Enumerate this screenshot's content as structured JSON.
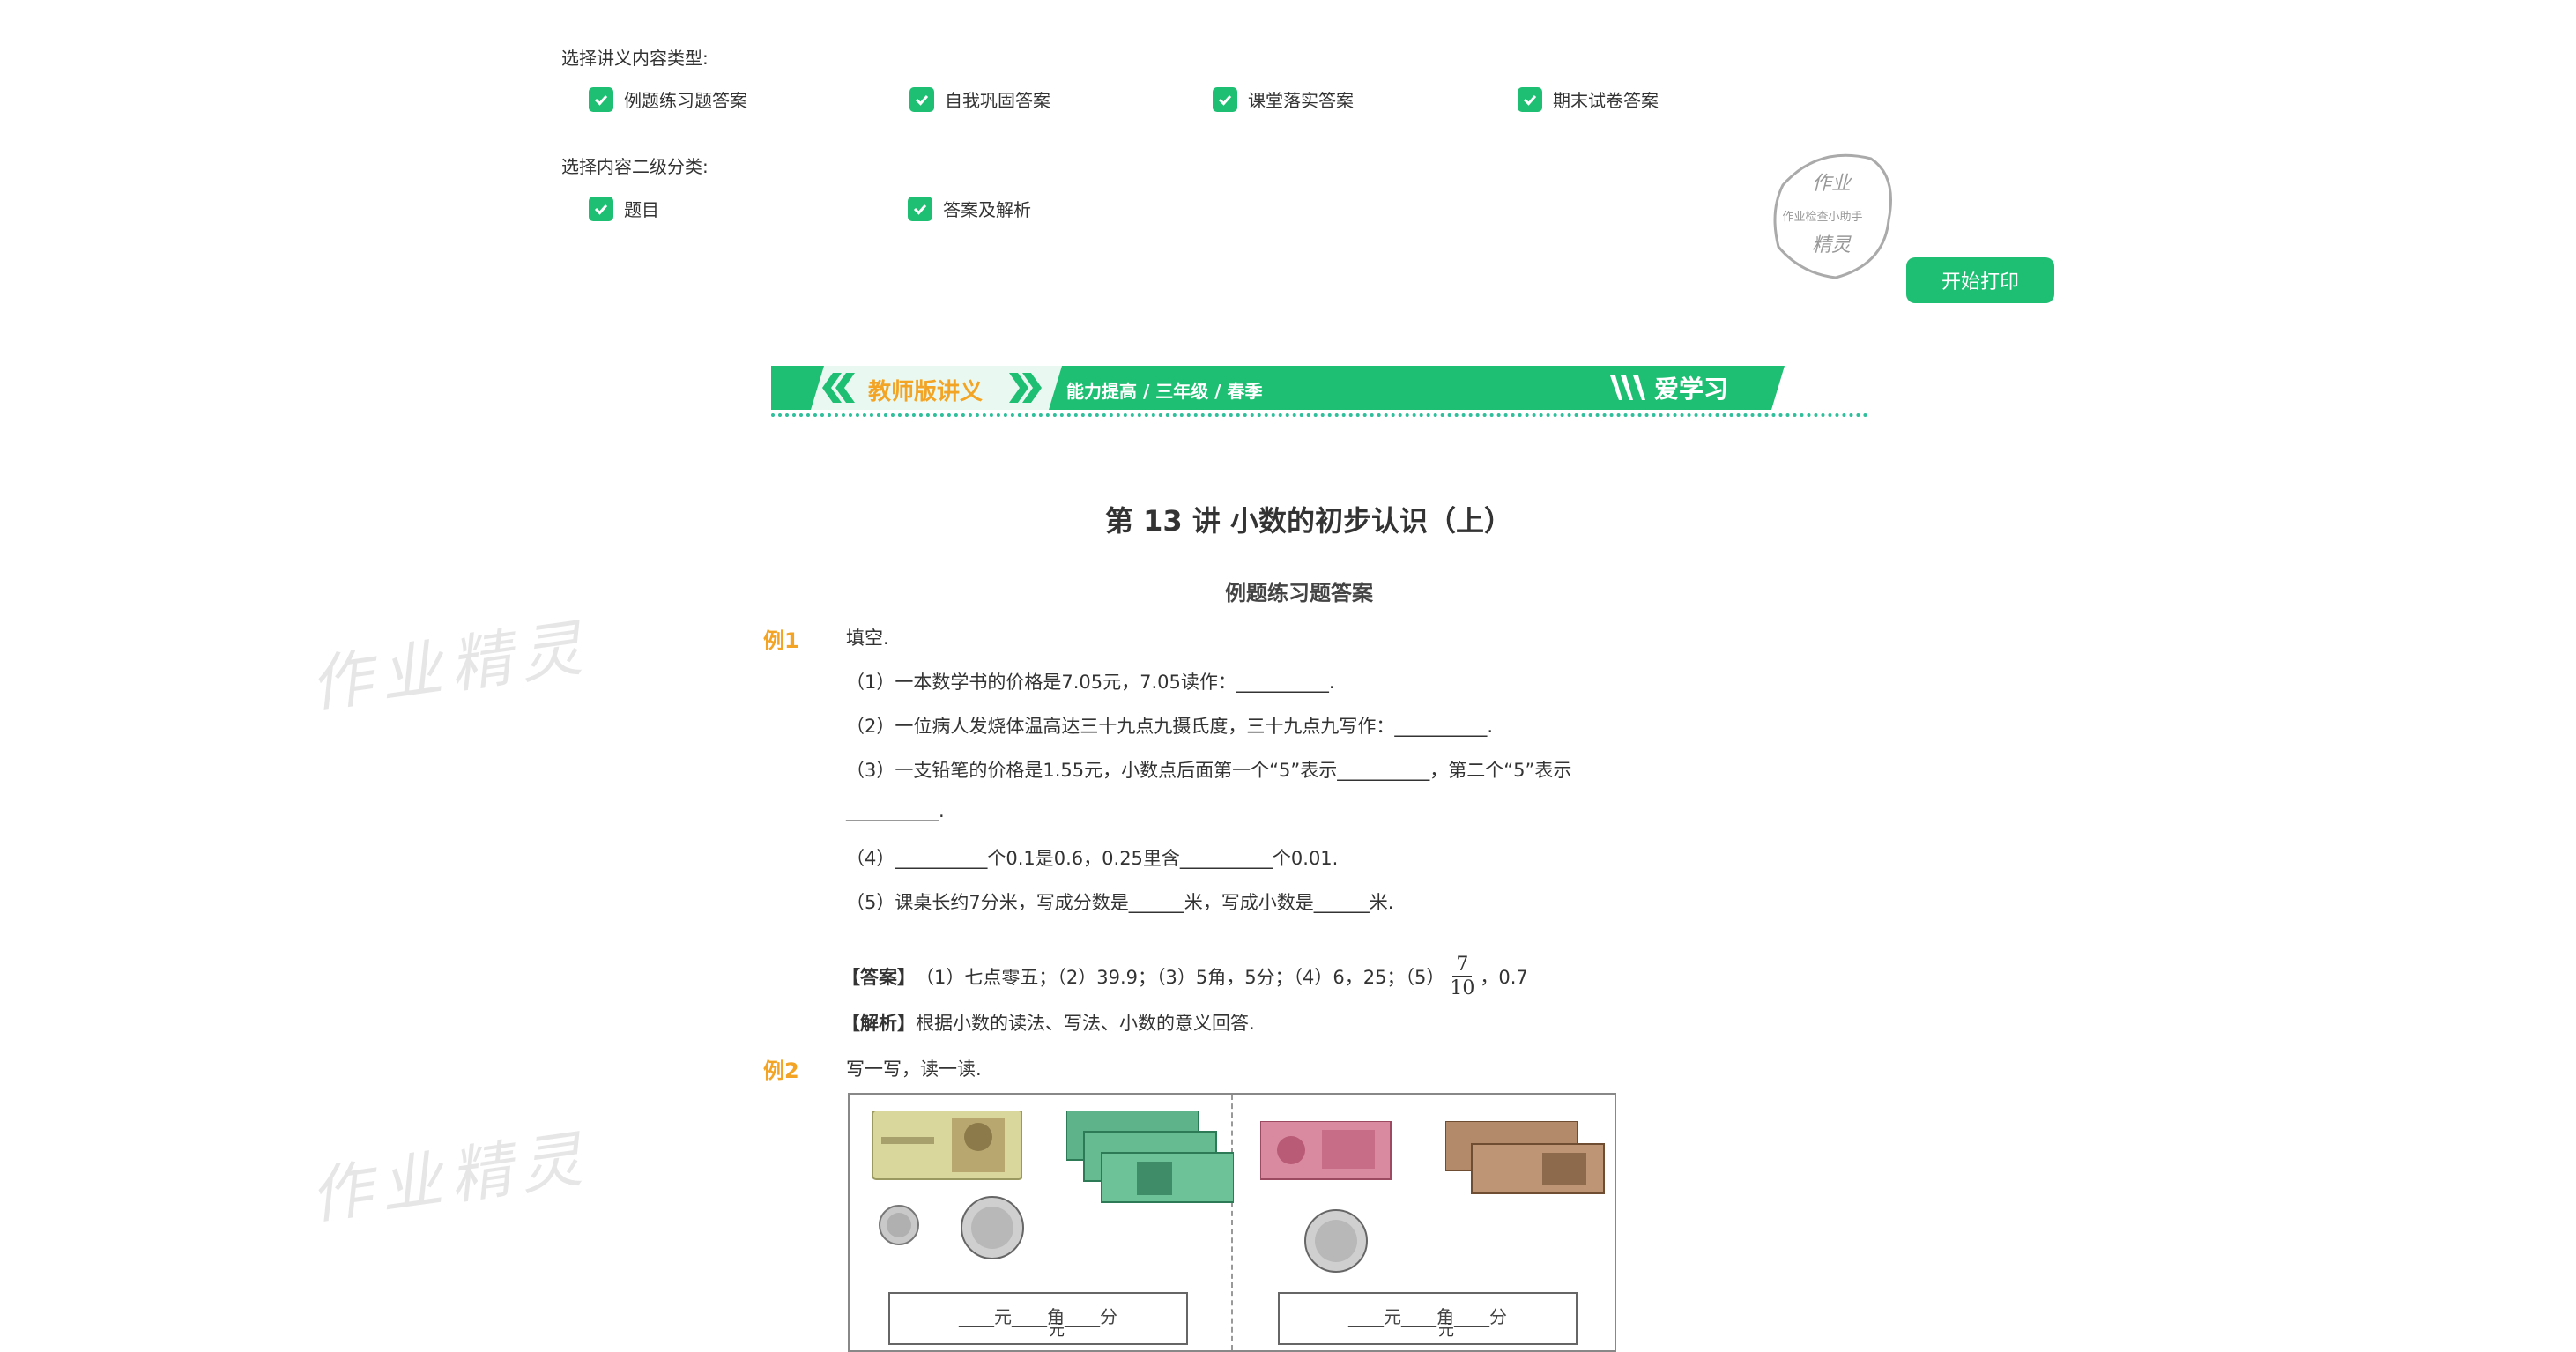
{
  "options": {
    "content_type_label": "选择讲义内容类型:",
    "content_types": [
      {
        "label": "例题练习题答案"
      },
      {
        "label": "自我巩固答案"
      },
      {
        "label": "课堂落实答案"
      },
      {
        "label": "期末试卷答案"
      }
    ],
    "subcategory_label": "选择内容二级分类:",
    "subcategories": [
      {
        "label": "题目"
      },
      {
        "label": "答案及解析"
      }
    ],
    "print_button": "开始打印"
  },
  "stamp": {
    "top": "作业",
    "middle": "作业检查小助手",
    "bottom": "精灵"
  },
  "watermark": "作业精灵",
  "banner": {
    "left_text": "教师版讲义",
    "path": "能力提高 / 三年级 / 春季",
    "brand": "爱学习",
    "colors": {
      "green": "#1fbf73",
      "orange": "#f3a425",
      "white": "#ffffff"
    }
  },
  "doc": {
    "title": "第 13 讲  小数的初步认识（上）",
    "subtitle": "例题练习题答案",
    "ex1": {
      "label": "例1",
      "intro": "填空.",
      "q1": "（1）一本数学书的价格是7.05元，7.05读作：__________.",
      "q2": "（2）一位病人发烧体温高达三十九点九摄氏度，三十九点九写作：__________.",
      "q3a": "（3）一支铅笔的价格是1.55元，小数点后面第一个“5”表示__________，第二个“5”表示",
      "q3b": "__________.",
      "q4": "（4）__________个0.1是0.6，0.25里含__________个0.01.",
      "q5": "（5）课桌长约7分米，写成分数是______米，写成小数是______米.",
      "answer_label": "【答案】",
      "answer_text": "（1）七点零五；（2）39.9；（3）5角，5分；（4）6，25；（5）",
      "answer_frac_num": "7",
      "answer_frac_den": "10",
      "answer_tail": "，0.7",
      "analysis_label": "【解析】",
      "analysis_text": "根据小数的读法、写法、小数的意义回答."
    },
    "ex2": {
      "label": "例2",
      "intro": "写一写，读一读.",
      "box_left": "____元____角____分",
      "box_right": "____元____角____分",
      "box_tail": "元"
    }
  }
}
